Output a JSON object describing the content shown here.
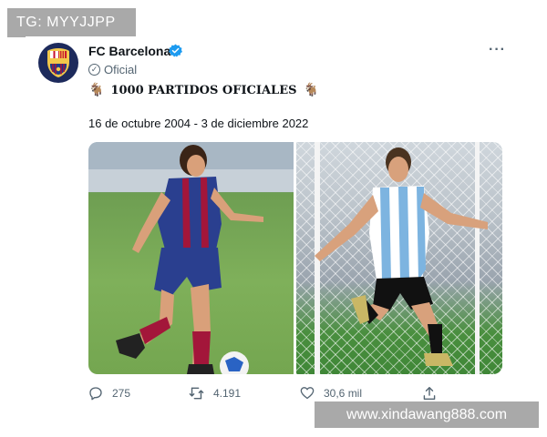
{
  "watermark_top": "TG: MYYJJPP",
  "watermark_bottom": "www.xindawang888.com",
  "post": {
    "account_name": "FC Barcelona",
    "verified": true,
    "badge_label": "Oficial",
    "headline": "1000 PARTIDOS OFICIALES",
    "dates": "16 de octubre 2004 - 3 de diciembre 2022",
    "more_label": "···",
    "media": [
      {
        "description": "player-barcelona-kit-dribbling",
        "colors": {
          "shirt_blue": "#2a3f8f",
          "shirt_red": "#a3163a"
        }
      },
      {
        "description": "player-argentina-kit-celebrating",
        "colors": {
          "shirt_sky": "#7db4e0",
          "shorts": "#111111"
        }
      }
    ],
    "actions": {
      "replies": "275",
      "reposts": "4.191",
      "likes": "30,6 mil"
    }
  },
  "colors": {
    "verified_blue": "#1d9bf0",
    "muted_text": "#536471",
    "text": "#0f1419"
  }
}
